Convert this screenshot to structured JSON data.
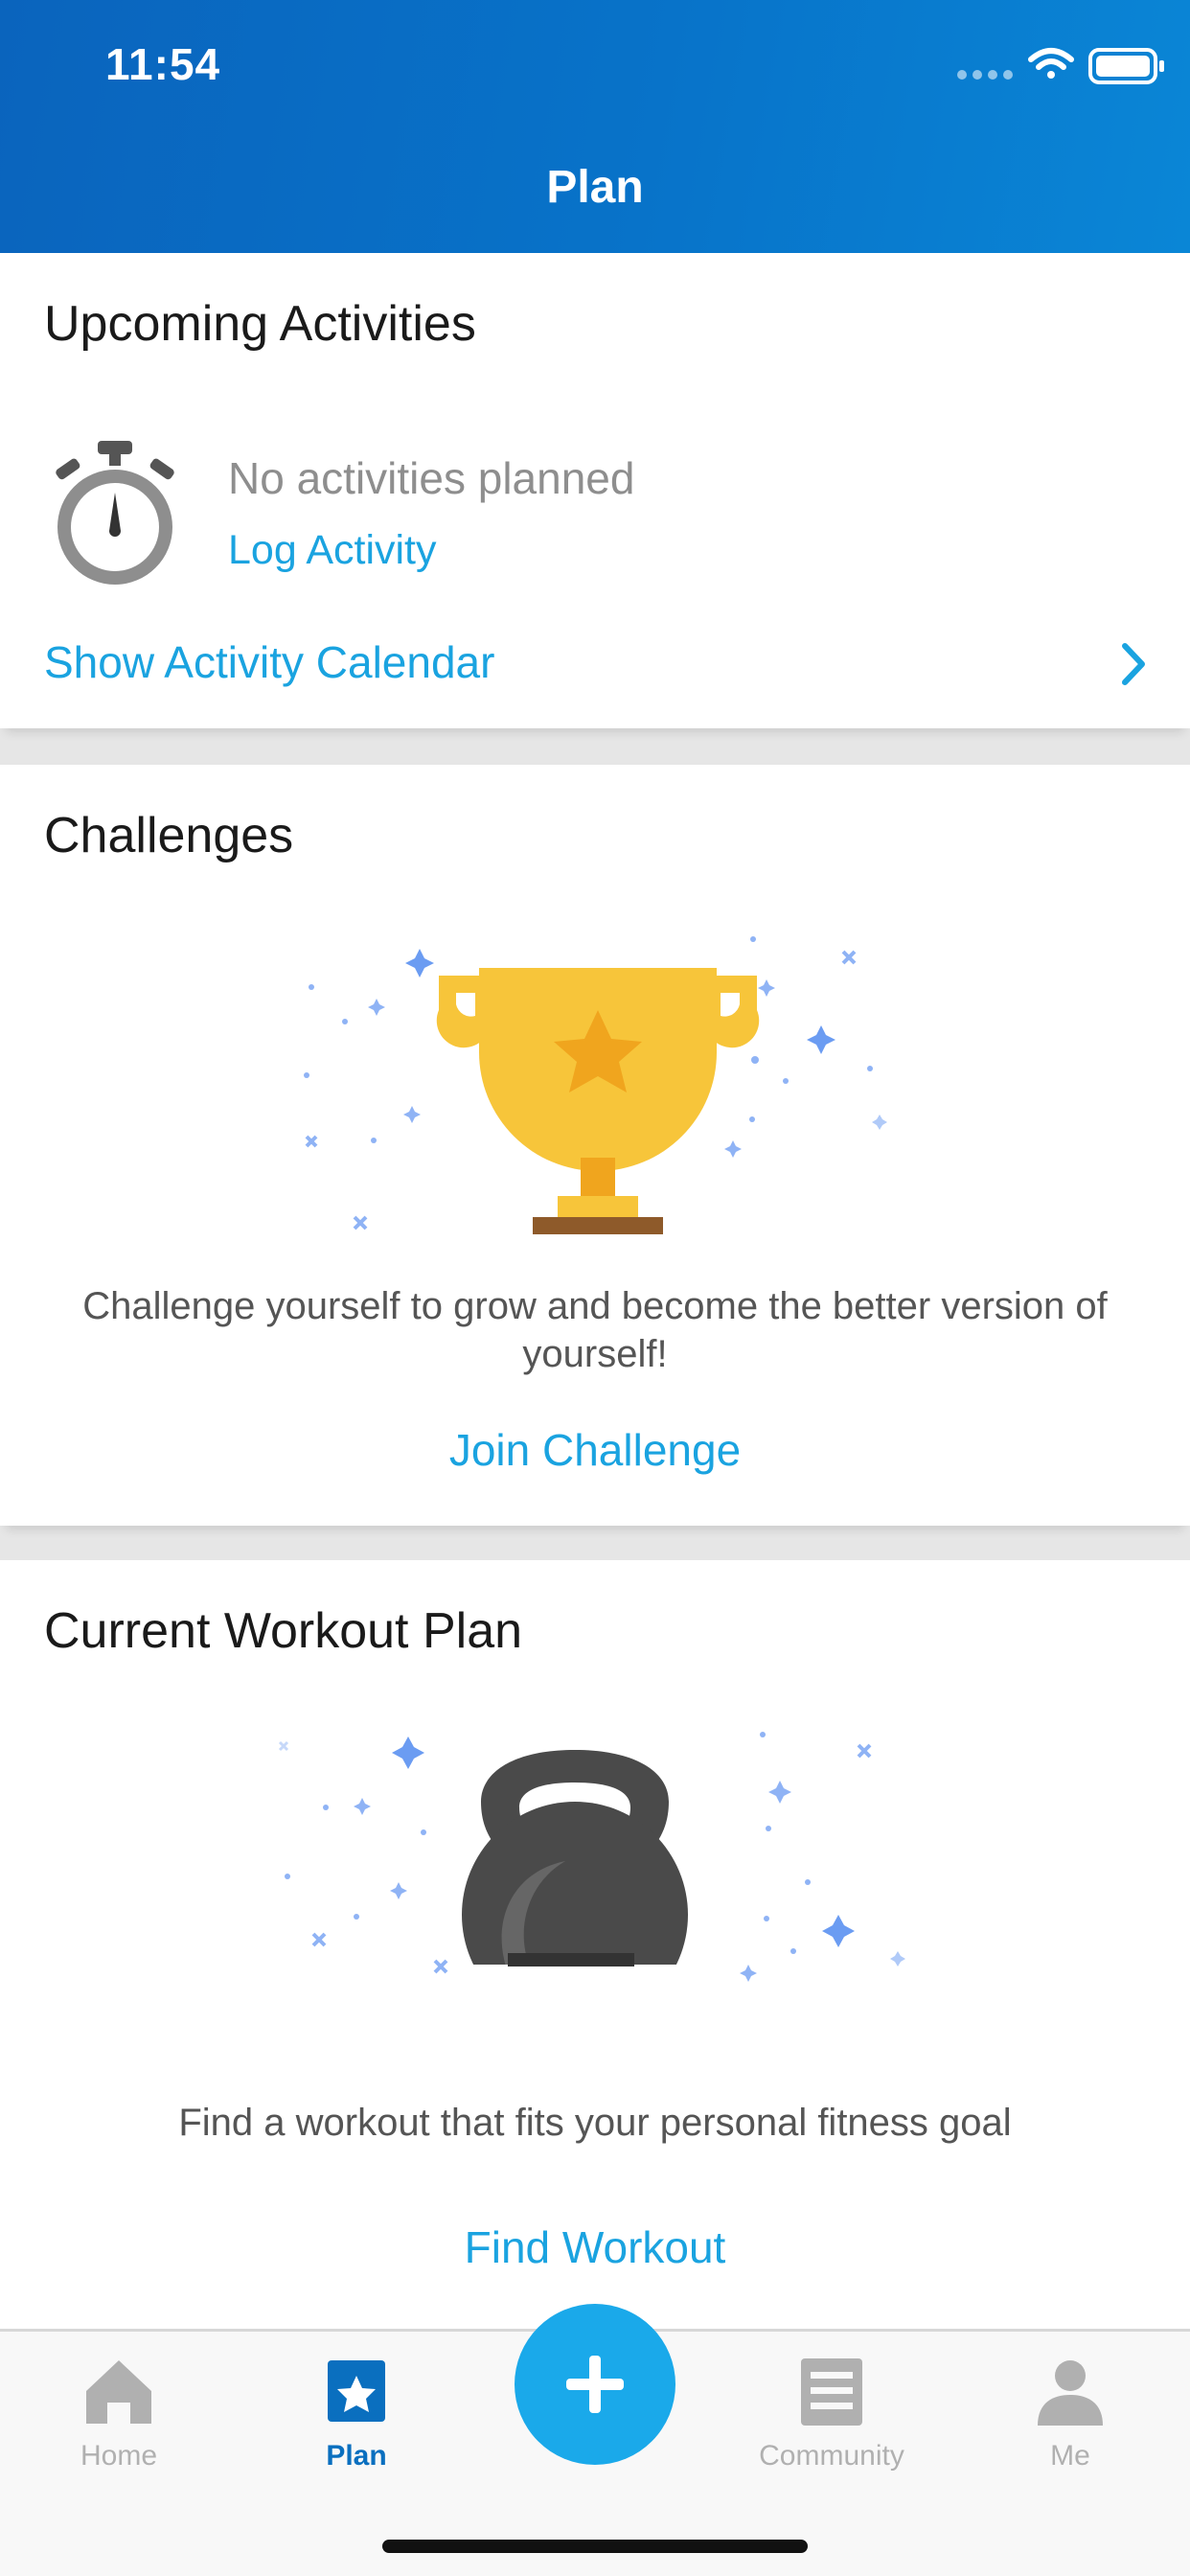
{
  "status_bar": {
    "time": "11:54"
  },
  "header": {
    "title": "Plan"
  },
  "upcoming": {
    "title": "Upcoming Activities",
    "empty_text": "No activities planned",
    "log_link": "Log Activity",
    "calendar_link": "Show Activity Calendar"
  },
  "challenges": {
    "title": "Challenges",
    "description": "Challenge yourself to grow and become the better version of yourself!",
    "action": "Join Challenge"
  },
  "workout": {
    "title": "Current Workout Plan",
    "description": "Find a workout that fits your personal fitness goal",
    "action": "Find Workout"
  },
  "tabs": [
    {
      "label": "Home",
      "icon": "house-icon",
      "active": false
    },
    {
      "label": "Plan",
      "icon": "star-calendar-icon",
      "active": true
    },
    {
      "label": "Community",
      "icon": "newspaper-icon",
      "active": false
    },
    {
      "label": "Me",
      "icon": "person-icon",
      "active": false
    }
  ],
  "colors": {
    "header_start": "#0a64bd",
    "header_end": "#0a86d6",
    "link": "#1aa3e0",
    "fab": "#1aa9ea",
    "tab_active": "#0a6fbf",
    "tab_inactive": "#b0b0b0"
  }
}
